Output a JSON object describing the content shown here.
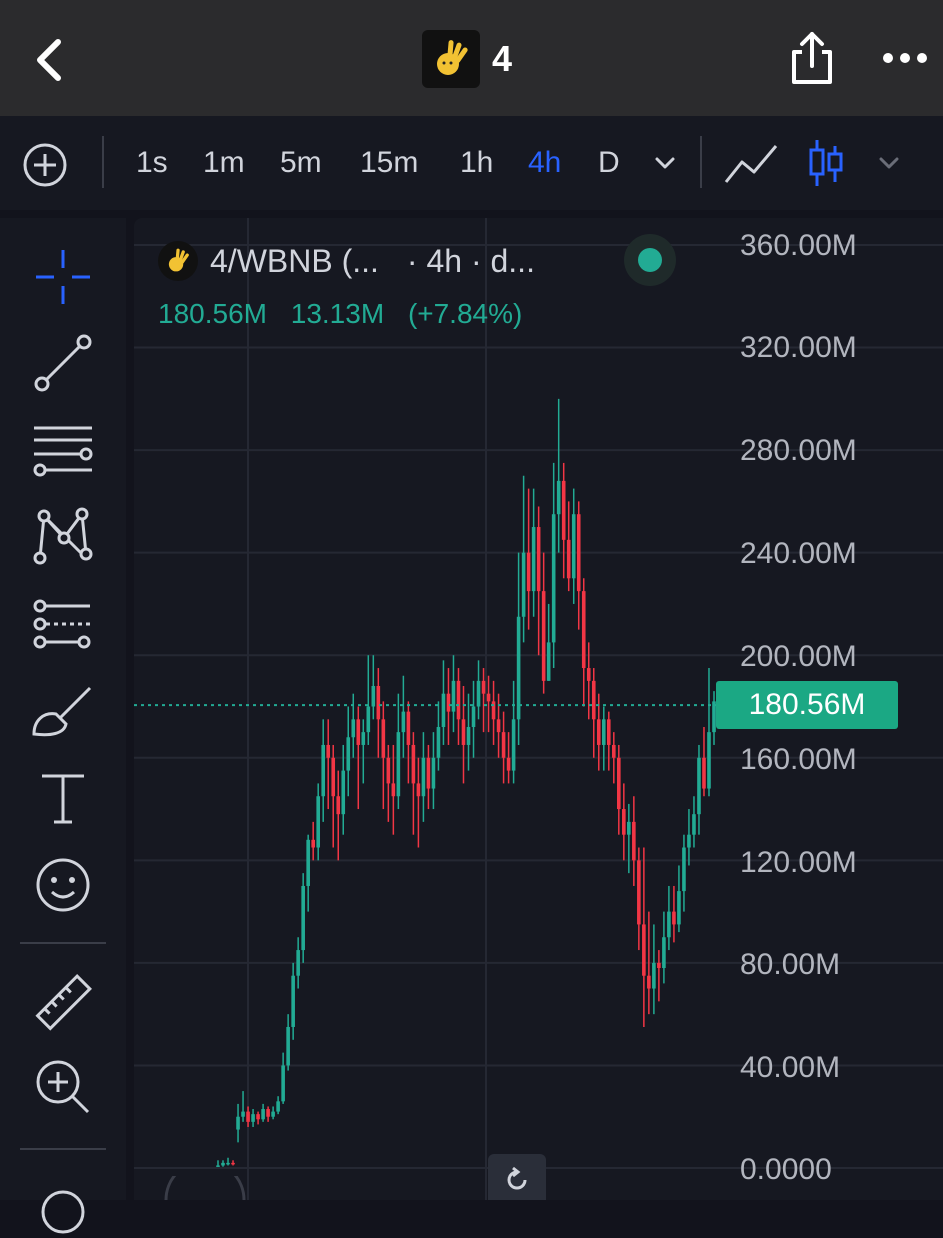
{
  "header": {
    "title": "4",
    "back_icon": "chevron-left-icon",
    "share_icon": "share-icon",
    "more_icon": "more-horizontal-icon",
    "logo_icon": "hand-logo-icon"
  },
  "toolbar": {
    "add_icon": "plus-circle-icon",
    "intervals": [
      "1s",
      "1m",
      "5m",
      "15m",
      "1h",
      "4h",
      "D"
    ],
    "active_interval": "4h",
    "interval_dropdown_icon": "chevron-down-icon",
    "line_chart_icon": "line-chart-icon",
    "candle_chart_icon": "candlestick-icon",
    "chart_type_dropdown_icon": "chevron-down-icon"
  },
  "sidebar": {
    "tools": [
      "crosshair-icon",
      "trend-line-icon",
      "horizontal-lines-icon",
      "pattern-icon",
      "fib-retracement-icon",
      "brush-icon",
      "text-tool-icon",
      "emoji-icon",
      "ruler-icon",
      "zoom-in-icon"
    ]
  },
  "legend": {
    "symbol": "4/WBNB (...",
    "meta": "· 4h · d...",
    "close": "180.56M",
    "change": "13.13M",
    "change_pct": "(+7.84%)"
  },
  "colors": {
    "up": "#22ab94",
    "down": "#f23645",
    "accent": "#2962ff",
    "background": "#161821"
  },
  "current_price": "180.56M",
  "chart_data": {
    "type": "candlestick",
    "interval": "4h",
    "ylim": [
      0,
      360000000
    ],
    "y_ticks": [
      "360.00M",
      "320.00M",
      "280.00M",
      "240.00M",
      "200.00M",
      "160.00M",
      "120.00M",
      "80.00M",
      "40.00M",
      "0.0000"
    ],
    "last_price": 180560000,
    "series": [
      {
        "ohlc": [
          [
            1,
            1,
            3,
            0.5
          ],
          [
            1,
            2,
            3,
            0.5
          ],
          [
            2,
            2,
            4,
            1
          ],
          [
            2,
            1.5,
            3,
            1
          ],
          [
            15,
            20,
            25,
            10
          ],
          [
            20,
            22,
            30,
            18
          ],
          [
            22,
            18,
            24,
            16
          ],
          [
            18,
            21,
            23,
            16
          ],
          [
            21,
            19,
            22,
            17
          ],
          [
            19,
            23,
            25,
            18
          ],
          [
            23,
            20,
            24,
            18
          ],
          [
            20,
            22,
            24,
            19
          ],
          [
            22,
            26,
            28,
            21
          ],
          [
            26,
            40,
            45,
            25
          ],
          [
            40,
            55,
            60,
            38
          ],
          [
            55,
            75,
            80,
            50
          ],
          [
            75,
            85,
            90,
            70
          ],
          [
            85,
            110,
            115,
            80
          ],
          [
            110,
            128,
            130,
            100
          ],
          [
            128,
            125,
            135,
            120
          ],
          [
            125,
            145,
            150,
            120
          ],
          [
            145,
            165,
            175,
            135
          ],
          [
            165,
            160,
            175,
            140
          ],
          [
            160,
            145,
            165,
            125
          ],
          [
            145,
            138,
            155,
            120
          ],
          [
            138,
            155,
            165,
            130
          ],
          [
            155,
            168,
            180,
            145
          ],
          [
            168,
            175,
            185,
            160
          ],
          [
            175,
            165,
            180,
            140
          ],
          [
            165,
            170,
            175,
            150
          ],
          [
            170,
            180,
            200,
            165
          ],
          [
            180,
            188,
            200,
            175
          ],
          [
            188,
            175,
            195,
            160
          ],
          [
            175,
            160,
            182,
            140
          ],
          [
            160,
            150,
            165,
            135
          ],
          [
            150,
            145,
            165,
            130
          ],
          [
            145,
            170,
            185,
            140
          ],
          [
            170,
            178,
            192,
            160
          ],
          [
            178,
            165,
            182,
            150
          ],
          [
            165,
            150,
            170,
            130
          ],
          [
            150,
            145,
            160,
            125
          ],
          [
            145,
            160,
            170,
            135
          ],
          [
            160,
            148,
            165,
            140
          ],
          [
            148,
            160,
            170,
            140
          ],
          [
            160,
            172,
            182,
            155
          ],
          [
            172,
            185,
            198,
            165
          ],
          [
            185,
            178,
            195,
            165
          ],
          [
            178,
            190,
            200,
            170
          ],
          [
            190,
            175,
            195,
            165
          ],
          [
            175,
            165,
            188,
            150
          ],
          [
            165,
            172,
            185,
            155
          ],
          [
            172,
            180,
            190,
            160
          ],
          [
            180,
            190,
            198,
            175
          ],
          [
            190,
            185,
            195,
            170
          ],
          [
            185,
            182,
            192,
            170
          ],
          [
            182,
            175,
            190,
            165
          ],
          [
            175,
            170,
            185,
            160
          ],
          [
            170,
            160,
            178,
            150
          ],
          [
            160,
            155,
            170,
            150
          ],
          [
            155,
            175,
            190,
            150
          ],
          [
            175,
            215,
            240,
            165
          ],
          [
            215,
            240,
            270,
            205
          ],
          [
            240,
            225,
            265,
            210
          ],
          [
            225,
            250,
            265,
            215
          ],
          [
            250,
            225,
            258,
            200
          ],
          [
            225,
            190,
            240,
            185
          ],
          [
            190,
            205,
            220,
            190
          ],
          [
            205,
            255,
            275,
            195
          ],
          [
            255,
            268,
            300,
            240
          ],
          [
            268,
            245,
            275,
            230
          ],
          [
            245,
            230,
            260,
            225
          ],
          [
            230,
            255,
            265,
            220
          ],
          [
            255,
            225,
            260,
            210
          ],
          [
            225,
            195,
            230,
            180
          ],
          [
            195,
            190,
            205,
            175
          ],
          [
            190,
            175,
            195,
            160
          ],
          [
            175,
            165,
            185,
            155
          ],
          [
            165,
            175,
            180,
            155
          ],
          [
            175,
            165,
            178,
            155
          ],
          [
            165,
            160,
            170,
            150
          ],
          [
            160,
            140,
            165,
            130
          ],
          [
            140,
            130,
            150,
            120
          ],
          [
            130,
            135,
            142,
            115
          ],
          [
            135,
            120,
            145,
            110
          ],
          [
            120,
            95,
            125,
            85
          ],
          [
            95,
            75,
            125,
            55
          ],
          [
            75,
            70,
            100,
            60
          ],
          [
            70,
            80,
            95,
            60
          ],
          [
            80,
            78,
            85,
            65
          ],
          [
            78,
            90,
            100,
            72
          ],
          [
            90,
            100,
            110,
            85
          ],
          [
            100,
            95,
            110,
            88
          ],
          [
            95,
            108,
            118,
            92
          ],
          [
            108,
            125,
            130,
            100
          ],
          [
            125,
            130,
            140,
            118
          ],
          [
            130,
            138,
            145,
            125
          ],
          [
            138,
            160,
            165,
            130
          ],
          [
            160,
            148,
            172,
            145
          ],
          [
            148,
            170,
            195,
            145
          ],
          [
            170,
            182,
            186,
            165
          ]
        ]
      }
    ]
  }
}
